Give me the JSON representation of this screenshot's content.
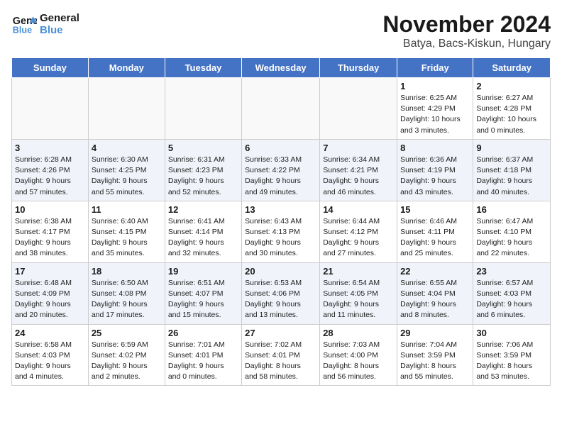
{
  "header": {
    "logo_line1": "General",
    "logo_line2": "Blue",
    "title": "November 2024",
    "subtitle": "Batya, Bacs-Kiskun, Hungary"
  },
  "days_of_week": [
    "Sunday",
    "Monday",
    "Tuesday",
    "Wednesday",
    "Thursday",
    "Friday",
    "Saturday"
  ],
  "weeks": [
    [
      {
        "day": "",
        "info": ""
      },
      {
        "day": "",
        "info": ""
      },
      {
        "day": "",
        "info": ""
      },
      {
        "day": "",
        "info": ""
      },
      {
        "day": "",
        "info": ""
      },
      {
        "day": "1",
        "info": "Sunrise: 6:25 AM\nSunset: 4:29 PM\nDaylight: 10 hours\nand 3 minutes."
      },
      {
        "day": "2",
        "info": "Sunrise: 6:27 AM\nSunset: 4:28 PM\nDaylight: 10 hours\nand 0 minutes."
      }
    ],
    [
      {
        "day": "3",
        "info": "Sunrise: 6:28 AM\nSunset: 4:26 PM\nDaylight: 9 hours\nand 57 minutes."
      },
      {
        "day": "4",
        "info": "Sunrise: 6:30 AM\nSunset: 4:25 PM\nDaylight: 9 hours\nand 55 minutes."
      },
      {
        "day": "5",
        "info": "Sunrise: 6:31 AM\nSunset: 4:23 PM\nDaylight: 9 hours\nand 52 minutes."
      },
      {
        "day": "6",
        "info": "Sunrise: 6:33 AM\nSunset: 4:22 PM\nDaylight: 9 hours\nand 49 minutes."
      },
      {
        "day": "7",
        "info": "Sunrise: 6:34 AM\nSunset: 4:21 PM\nDaylight: 9 hours\nand 46 minutes."
      },
      {
        "day": "8",
        "info": "Sunrise: 6:36 AM\nSunset: 4:19 PM\nDaylight: 9 hours\nand 43 minutes."
      },
      {
        "day": "9",
        "info": "Sunrise: 6:37 AM\nSunset: 4:18 PM\nDaylight: 9 hours\nand 40 minutes."
      }
    ],
    [
      {
        "day": "10",
        "info": "Sunrise: 6:38 AM\nSunset: 4:17 PM\nDaylight: 9 hours\nand 38 minutes."
      },
      {
        "day": "11",
        "info": "Sunrise: 6:40 AM\nSunset: 4:15 PM\nDaylight: 9 hours\nand 35 minutes."
      },
      {
        "day": "12",
        "info": "Sunrise: 6:41 AM\nSunset: 4:14 PM\nDaylight: 9 hours\nand 32 minutes."
      },
      {
        "day": "13",
        "info": "Sunrise: 6:43 AM\nSunset: 4:13 PM\nDaylight: 9 hours\nand 30 minutes."
      },
      {
        "day": "14",
        "info": "Sunrise: 6:44 AM\nSunset: 4:12 PM\nDaylight: 9 hours\nand 27 minutes."
      },
      {
        "day": "15",
        "info": "Sunrise: 6:46 AM\nSunset: 4:11 PM\nDaylight: 9 hours\nand 25 minutes."
      },
      {
        "day": "16",
        "info": "Sunrise: 6:47 AM\nSunset: 4:10 PM\nDaylight: 9 hours\nand 22 minutes."
      }
    ],
    [
      {
        "day": "17",
        "info": "Sunrise: 6:48 AM\nSunset: 4:09 PM\nDaylight: 9 hours\nand 20 minutes."
      },
      {
        "day": "18",
        "info": "Sunrise: 6:50 AM\nSunset: 4:08 PM\nDaylight: 9 hours\nand 17 minutes."
      },
      {
        "day": "19",
        "info": "Sunrise: 6:51 AM\nSunset: 4:07 PM\nDaylight: 9 hours\nand 15 minutes."
      },
      {
        "day": "20",
        "info": "Sunrise: 6:53 AM\nSunset: 4:06 PM\nDaylight: 9 hours\nand 13 minutes."
      },
      {
        "day": "21",
        "info": "Sunrise: 6:54 AM\nSunset: 4:05 PM\nDaylight: 9 hours\nand 11 minutes."
      },
      {
        "day": "22",
        "info": "Sunrise: 6:55 AM\nSunset: 4:04 PM\nDaylight: 9 hours\nand 8 minutes."
      },
      {
        "day": "23",
        "info": "Sunrise: 6:57 AM\nSunset: 4:03 PM\nDaylight: 9 hours\nand 6 minutes."
      }
    ],
    [
      {
        "day": "24",
        "info": "Sunrise: 6:58 AM\nSunset: 4:03 PM\nDaylight: 9 hours\nand 4 minutes."
      },
      {
        "day": "25",
        "info": "Sunrise: 6:59 AM\nSunset: 4:02 PM\nDaylight: 9 hours\nand 2 minutes."
      },
      {
        "day": "26",
        "info": "Sunrise: 7:01 AM\nSunset: 4:01 PM\nDaylight: 9 hours\nand 0 minutes."
      },
      {
        "day": "27",
        "info": "Sunrise: 7:02 AM\nSunset: 4:01 PM\nDaylight: 8 hours\nand 58 minutes."
      },
      {
        "day": "28",
        "info": "Sunrise: 7:03 AM\nSunset: 4:00 PM\nDaylight: 8 hours\nand 56 minutes."
      },
      {
        "day": "29",
        "info": "Sunrise: 7:04 AM\nSunset: 3:59 PM\nDaylight: 8 hours\nand 55 minutes."
      },
      {
        "day": "30",
        "info": "Sunrise: 7:06 AM\nSunset: 3:59 PM\nDaylight: 8 hours\nand 53 minutes."
      }
    ]
  ]
}
